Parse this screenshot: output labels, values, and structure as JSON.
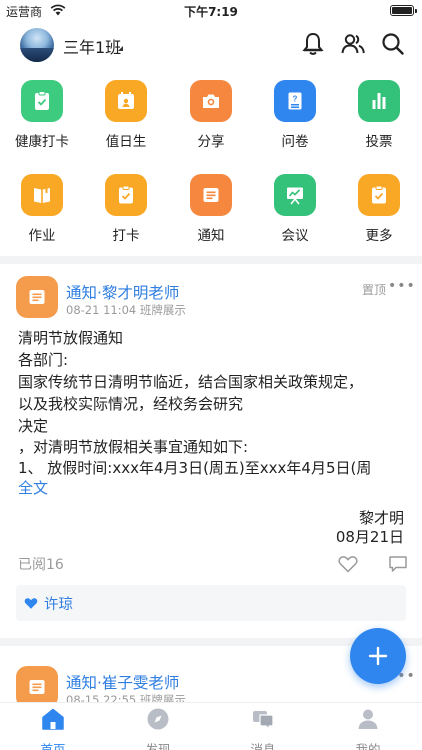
{
  "status_bar": {
    "carrier": "运营商",
    "time": "下午7:19"
  },
  "header": {
    "class_name": "三年1班"
  },
  "functions": [
    {
      "label": "健康打卡",
      "icon": "health-checkin-icon",
      "color": "#3ccb7f"
    },
    {
      "label": "值日生",
      "icon": "duty-student-icon",
      "color": "#f9a825"
    },
    {
      "label": "分享",
      "icon": "camera-icon",
      "color": "#f5873f"
    },
    {
      "label": "问卷",
      "icon": "questionnaire-icon",
      "color": "#2f86ee"
    },
    {
      "label": "投票",
      "icon": "bar-chart-icon",
      "color": "#34c27a"
    },
    {
      "label": "作业",
      "icon": "homework-book-icon",
      "color": "#f9a825"
    },
    {
      "label": "打卡",
      "icon": "checkin-clipboard-icon",
      "color": "#f9a825"
    },
    {
      "label": "通知",
      "icon": "notice-icon",
      "color": "#f5873f"
    },
    {
      "label": "会议",
      "icon": "meeting-board-icon",
      "color": "#34c27a"
    },
    {
      "label": "更多",
      "icon": "more-clipboard-icon",
      "color": "#f9a825"
    }
  ],
  "posts": [
    {
      "title": "通知·黎才明老师",
      "meta": "08-21 11:04 班牌展示",
      "pin_label": "置顶",
      "body_lines": [
        "清明节放假通知",
        "各部门:",
        "国家传统节日清明节临近，结合国家相关政策规定，",
        "以及我校实际情况，经校务会研究",
        "决定",
        "，对清明节放假相关事宜通知如下:",
        "1、 放假时间:xxx年4月3日(周五)至xxx年4月5日(周"
      ],
      "full_text_link": "全文",
      "signature_name": "黎才明",
      "signature_date": "08月21日",
      "read_count": "已阅16",
      "liked_by": "许琼"
    },
    {
      "title": "通知·崔子雯老师",
      "meta": "08-15 22:55 班牌展示"
    }
  ],
  "tabs": [
    {
      "label": "首页",
      "icon": "home-icon",
      "active": true
    },
    {
      "label": "发现",
      "icon": "compass-icon",
      "active": false
    },
    {
      "label": "消息",
      "icon": "message-icon",
      "active": false
    },
    {
      "label": "我的",
      "icon": "profile-icon",
      "active": false
    }
  ],
  "colors": {
    "accent": "#2f86ee",
    "link": "#2f7ee0",
    "notice_orange": "#f59b4c"
  }
}
